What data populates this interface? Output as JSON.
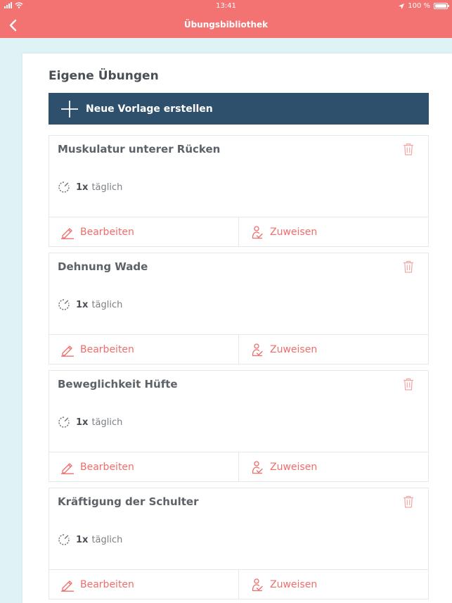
{
  "status_bar": {
    "time": "13:41",
    "battery": "100 %"
  },
  "nav": {
    "title": "Übungsbibliothek",
    "back_icon": "chevron-left-icon"
  },
  "section": {
    "title": "Eigene Übungen"
  },
  "new_button": {
    "label": "Neue Vorlage erstellen",
    "icon": "plus-icon"
  },
  "exercises": [
    {
      "name": "Muskulatur unterer Rücken",
      "count": "1x",
      "frequency": "täglich",
      "edit_label": "Bearbeiten",
      "assign_label": "Zuweisen"
    },
    {
      "name": "Dehnung Wade",
      "count": "1x",
      "frequency": "täglich",
      "edit_label": "Bearbeiten",
      "assign_label": "Zuweisen"
    },
    {
      "name": "Beweglichkeit Hüfte",
      "count": "1x",
      "frequency": "täglich",
      "edit_label": "Bearbeiten",
      "assign_label": "Zuweisen"
    },
    {
      "name": "Kräftigung der Schulter",
      "count": "1x",
      "frequency": "täglich",
      "edit_label": "Bearbeiten",
      "assign_label": "Zuweisen"
    }
  ],
  "colors": {
    "accent": "#f37372",
    "primary_button": "#2e506c",
    "background": "#dff2f5",
    "action_text": "#f06d6a"
  }
}
